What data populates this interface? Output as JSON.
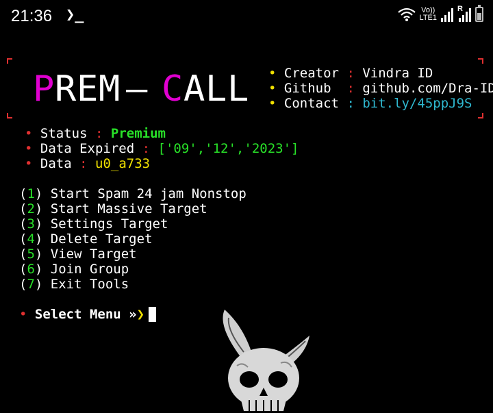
{
  "statusbar": {
    "time": "21:36",
    "terminal_glyph": "❯_",
    "volte_top": "Vo))",
    "volte_bottom": "LTE1",
    "roaming": "R"
  },
  "banner": {
    "logo": [
      "P",
      "R",
      "E",
      "M",
      "—",
      "C",
      "A",
      "L",
      "L"
    ]
  },
  "info": {
    "creator_label": "Creator",
    "creator_sep": ":",
    "creator_value": "Vindra ID",
    "github_label": "Github ",
    "github_sep": ":",
    "github_value": "github.com/Dra-ID",
    "contact_label": "Contact",
    "contact_sep": ":",
    "contact_value": "bit.ly/45ppJ9S"
  },
  "account": {
    "status_label": "Status",
    "status_sep": ":",
    "status_value": "Premium",
    "expired_label": "Data Expired",
    "expired_sep": ":",
    "expired_value": "['09','12','2023']",
    "data_label": "Data",
    "data_sep": ":",
    "data_value": "u0_a733"
  },
  "menu": [
    {
      "num": "1",
      "label": "Start Spam 24 jam Nonstop"
    },
    {
      "num": "2",
      "label": "Start Massive Target"
    },
    {
      "num": "3",
      "label": "Settings Target"
    },
    {
      "num": "4",
      "label": "Delete Target"
    },
    {
      "num": "5",
      "label": "View Target"
    },
    {
      "num": "6",
      "label": "Join Group"
    },
    {
      "num": "7",
      "label": "Exit Tools"
    }
  ],
  "select": {
    "label": "Select Menu »",
    "chevron": "❯"
  },
  "colors": {
    "accent_magenta": "#e000d0",
    "green": "#28e028",
    "yellow": "#f0e000",
    "cyan": "#2fb8d0",
    "red": "#e03030"
  }
}
